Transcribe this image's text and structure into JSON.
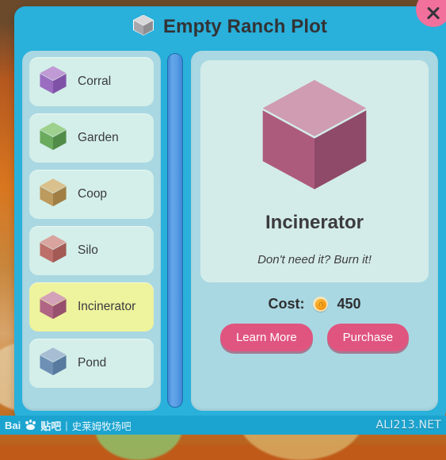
{
  "window": {
    "title": "Empty Ranch Plot",
    "title_icon": "cube-icon",
    "close_icon": "close-icon"
  },
  "sidebar": {
    "items": [
      {
        "label": "Corral",
        "icon": "cube-icon",
        "selected": false,
        "colors": {
          "top": "#c09ad4",
          "left": "#9a6dc0",
          "right": "#7f52a8"
        }
      },
      {
        "label": "Garden",
        "icon": "cube-icon",
        "selected": false,
        "colors": {
          "top": "#9ed08e",
          "left": "#6aab5e",
          "right": "#528c49"
        }
      },
      {
        "label": "Coop",
        "icon": "cube-icon",
        "selected": false,
        "colors": {
          "top": "#d9c08d",
          "left": "#bd9a5d",
          "right": "#a07e44"
        }
      },
      {
        "label": "Silo",
        "icon": "cube-icon",
        "selected": false,
        "colors": {
          "top": "#d9a49e",
          "left": "#bd706a",
          "right": "#a35a55"
        }
      },
      {
        "label": "Incinerator",
        "icon": "cube-icon",
        "selected": true,
        "colors": {
          "top": "#d3a2b8",
          "left": "#b06584",
          "right": "#97506d"
        }
      },
      {
        "label": "Pond",
        "icon": "cube-icon",
        "selected": false,
        "colors": {
          "top": "#a7bdd4",
          "left": "#6e90b5",
          "right": "#587a9e"
        }
      }
    ]
  },
  "scrollbar": {
    "name": "sidebar-scrollbar",
    "thumb_position_percent": 0
  },
  "detail": {
    "icon": "cube-icon",
    "icon_colors": {
      "top": "#cf9cb2",
      "left": "#ad5b7d",
      "right": "#8e4a68"
    },
    "name": "Incinerator",
    "description": "Don't need it? Burn it!",
    "cost_label": "Cost:",
    "cost_value": "450",
    "cost_icon": "coin-icon",
    "coin_glyph": "∩",
    "buttons": [
      {
        "label": "Learn More",
        "name": "learn-more-button"
      },
      {
        "label": "Purchase",
        "name": "purchase-button"
      }
    ]
  },
  "watermark": {
    "brand": "Bai",
    "paw_icon": "paw-icon",
    "brand_suffix": "贴吧",
    "separator": "|",
    "forum": "史莱姆牧场吧",
    "site": "ALI213.NET"
  },
  "colors": {
    "dialog": "#29b0db",
    "panel": "#a9d8e2",
    "card": "#d4ece9",
    "item": "#d4efe9",
    "item_selected": "#eef39d",
    "button": "#e05580",
    "close": "#f2709c",
    "scrollbar": "#5a9ee5"
  }
}
